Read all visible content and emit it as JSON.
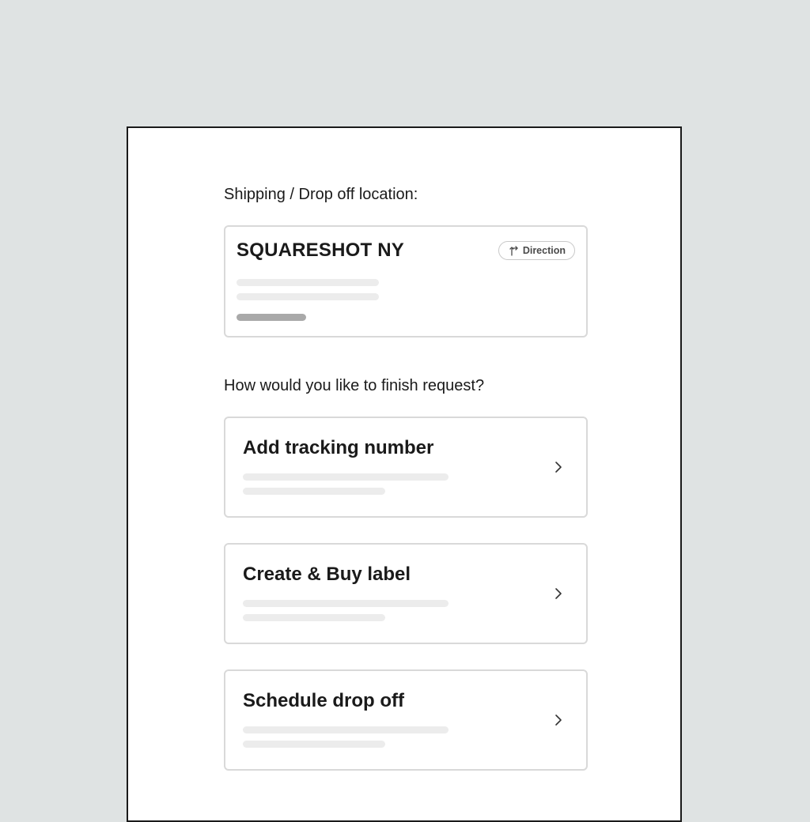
{
  "location": {
    "section_label": "Shipping / Drop off location:",
    "name": "SQUARESHOT NY",
    "direction_label": "Direction"
  },
  "finish": {
    "section_label": "How would you like to finish request?",
    "options": [
      {
        "title": "Add tracking number",
        "icon": "chevron-right-icon"
      },
      {
        "title": "Create & Buy label",
        "icon": "chevron-right-icon"
      },
      {
        "title": "Schedule drop off",
        "icon": "chevron-right-icon"
      }
    ]
  },
  "colors": {
    "background": "#dfe3e3",
    "card_border": "#d9d9d9",
    "skeleton": "#ececec",
    "skeleton_dark": "#a9a9a9",
    "text": "#1a1a1a"
  }
}
